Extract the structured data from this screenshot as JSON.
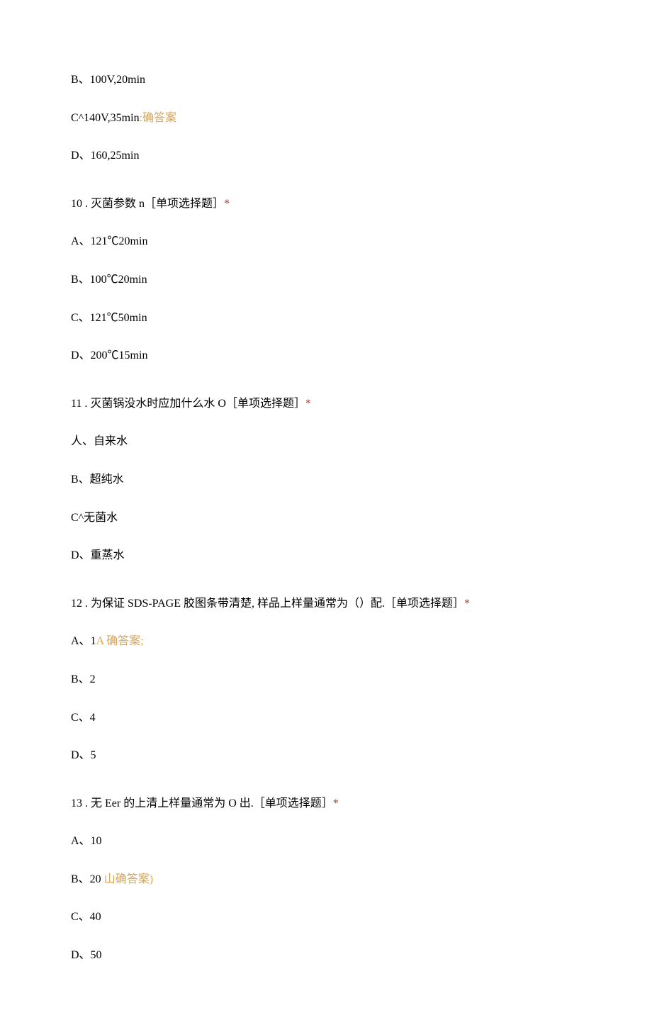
{
  "lines": {
    "l1": "B、100V,20min",
    "l2a": "C^140V,35min",
    "l2b": ":确答案",
    "l3": "D、160,25min",
    "q10": "10 . 灭菌参数 n［单项选择题］",
    "q10a": "A、121℃20min",
    "q10b": "B、100℃20min",
    "q10c": "C、121℃50min",
    "q10d": "D、200℃15min",
    "q11": "11 . 灭菌锅没水时应加什么水 O［单项选择题］",
    "q11a": "人、自来水",
    "q11b": "B、超纯水",
    "q11c": "C^无菌水",
    "q11d": "D、重蒸水",
    "q12": "12 . 为保证 SDS-PAGE 胶图条带清楚, 样品上样量通常为（）配.［单项选择题］",
    "q12a_main": "A、1",
    "q12a_hl": "A 确答案;",
    "q12b": "B、2",
    "q12c": "C、4",
    "q12d": "D、5",
    "q13": "13 . 无 Eer 的上清上样量通常为 O 出.［单项选择题］",
    "q13a": "A、10",
    "q13b_main": "B、20 ",
    "q13b_hl": "山确答案)",
    "q13c": "C、40",
    "q13d": "D、50",
    "star": "*"
  }
}
